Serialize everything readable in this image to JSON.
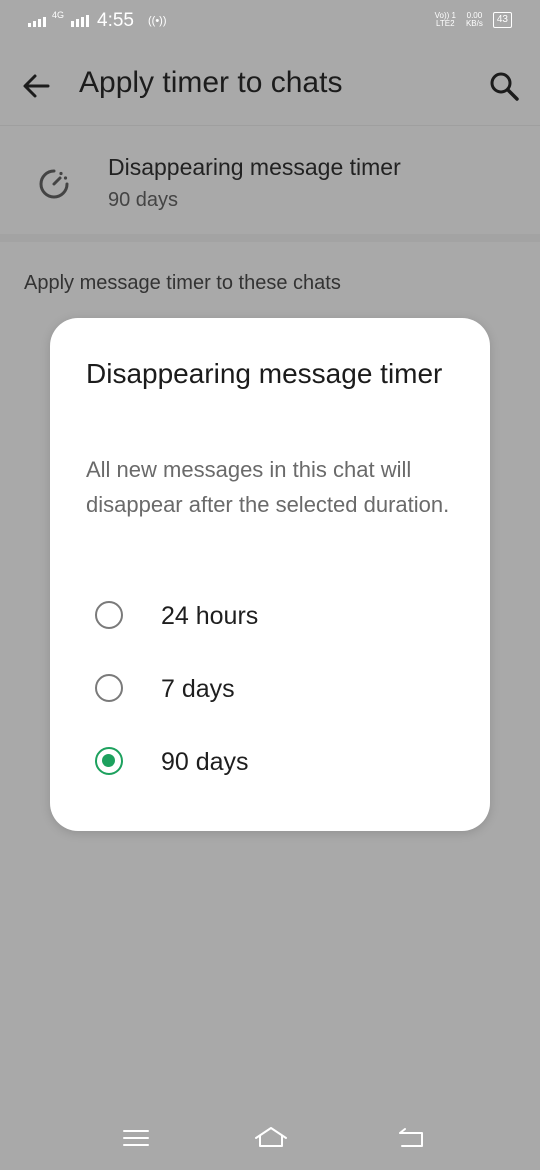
{
  "status_bar": {
    "network": "4G",
    "time": "4:55",
    "hotspot": "((•))",
    "volte_top": "Vo)) 1",
    "volte_bottom": "LTE2",
    "speed_top": "0.00",
    "speed_bottom": "KB/s",
    "battery": "43"
  },
  "header": {
    "title": "Apply timer to chats",
    "back_icon": "arrow-left-icon",
    "search_icon": "search-icon"
  },
  "timer_setting": {
    "icon": "timer-icon",
    "title": "Disappearing message timer",
    "value": "90 days"
  },
  "section": {
    "header": "Apply message timer to these chats"
  },
  "dialog": {
    "title": "Disappearing message timer",
    "body": "All new messages in this chat will disappear after the selected duration.",
    "options": [
      {
        "label": "24 hours",
        "selected": false
      },
      {
        "label": "7 days",
        "selected": false
      },
      {
        "label": "90 days",
        "selected": true
      }
    ]
  },
  "nav_bar": {
    "icons": [
      "menu-icon",
      "home-icon",
      "back-icon"
    ]
  },
  "colors": {
    "scrim": "#a9a9a9",
    "dialog_bg": "#ffffff",
    "accent": "#1da15e"
  }
}
